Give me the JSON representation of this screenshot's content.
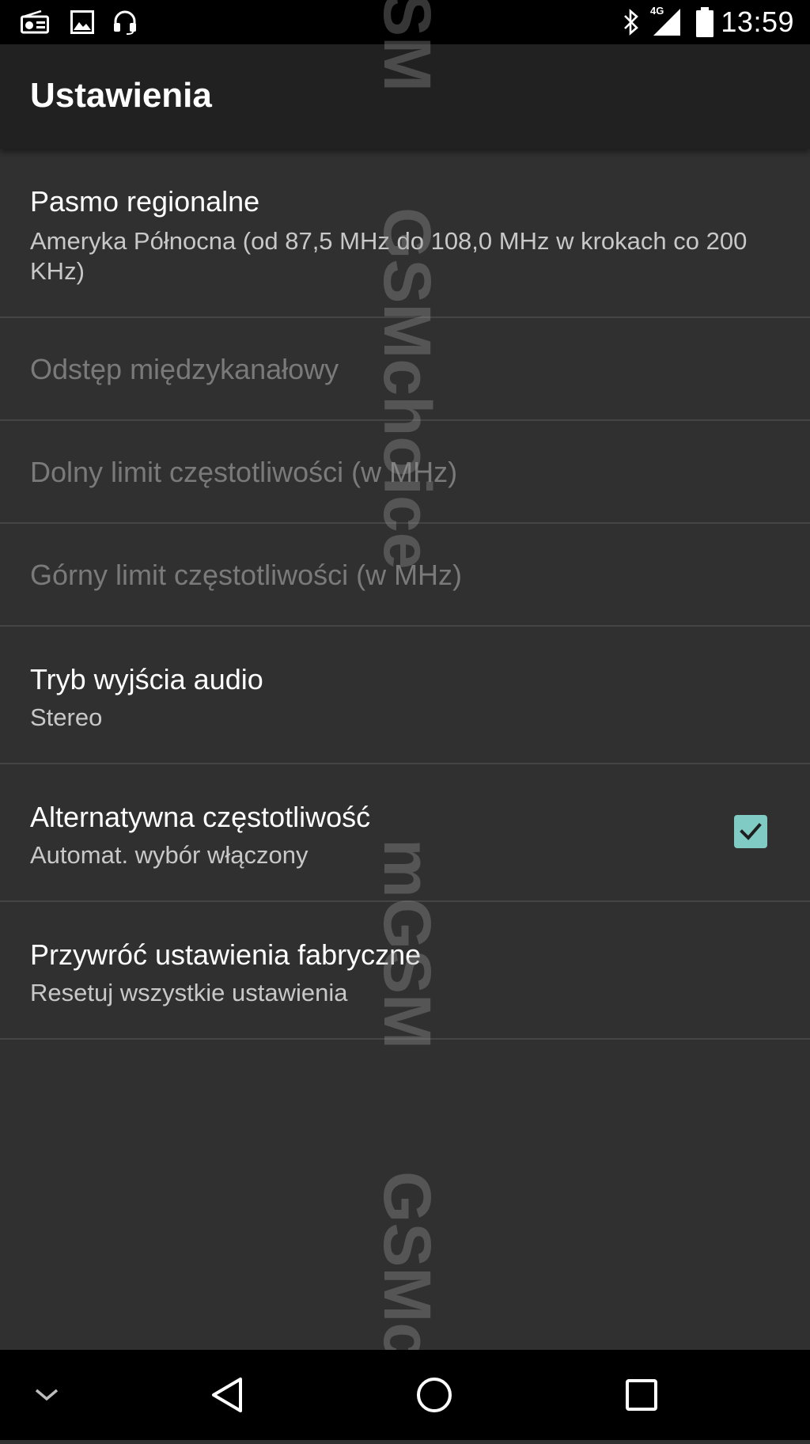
{
  "status_bar": {
    "left_icons": [
      "radio-icon",
      "image-icon",
      "headset-icon"
    ],
    "right_icons": [
      "bluetooth-icon",
      "signal-4g-icon",
      "battery-icon"
    ],
    "network_label": "4G",
    "time": "13:59"
  },
  "app_bar": {
    "title": "Ustawienia"
  },
  "settings": {
    "items": [
      {
        "title": "Pasmo regionalne",
        "summary": "Ameryka Północna (od 87,5 MHz do 108,0 MHz w krokach co 200 KHz)",
        "enabled": true
      },
      {
        "title": "Odstęp międzykanałowy",
        "summary": "",
        "enabled": false
      },
      {
        "title": "Dolny limit częstotliwości (w MHz)",
        "summary": "",
        "enabled": false
      },
      {
        "title": "Górny limit częstotliwości (w MHz)",
        "summary": "",
        "enabled": false
      },
      {
        "title": "Tryb wyjścia audio",
        "summary": "Stereo",
        "enabled": true
      },
      {
        "title": "Alternatywna częstotliwość",
        "summary": "Automat. wybór włączony",
        "enabled": true,
        "checked": true
      },
      {
        "title": "Przywróć ustawienia fabryczne",
        "summary": "Resetuj wszystkie ustawienia",
        "enabled": true
      }
    ]
  },
  "watermark": {
    "text": "GSMchoice"
  },
  "nav_bar": {
    "buttons": [
      "collapse-keyboard-icon",
      "back-icon",
      "home-icon",
      "recents-icon"
    ]
  },
  "colors": {
    "background": "#303030",
    "app_bar": "#212121",
    "status_bar": "#000000",
    "checkbox_accent": "#80cbc4",
    "divider": "#454545",
    "disabled_text": "#7a7a7a"
  }
}
